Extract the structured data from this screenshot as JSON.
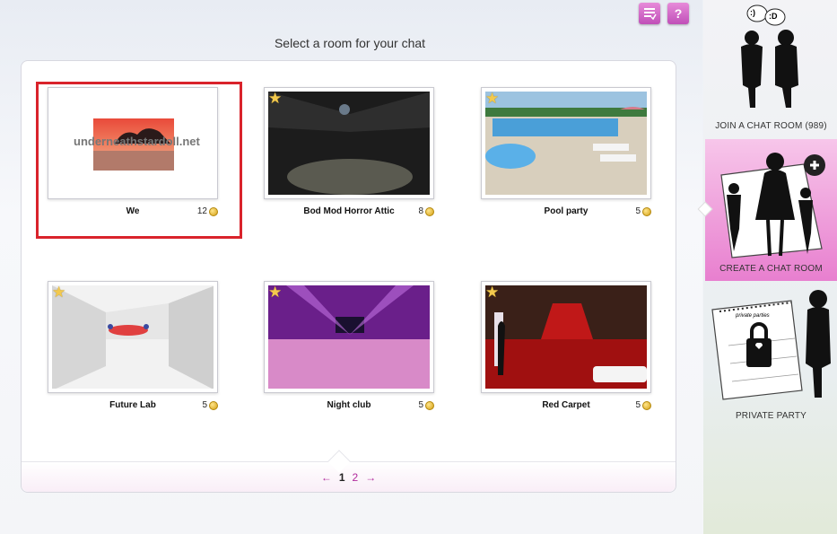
{
  "header": {
    "title": "Select a room for your chat",
    "icon_list": "list-check-icon",
    "icon_help": "help-icon",
    "help_glyph": "?"
  },
  "rooms": [
    {
      "name": "We",
      "count": "12",
      "starred": false,
      "selected": true,
      "watermark": "underneathstardoll.net"
    },
    {
      "name": "Bod Mod Horror Attic",
      "count": "8",
      "starred": true,
      "selected": false
    },
    {
      "name": "Pool party",
      "count": "5",
      "starred": true,
      "selected": false
    },
    {
      "name": "Future Lab",
      "count": "5",
      "starred": true,
      "selected": false
    },
    {
      "name": "Night club",
      "count": "5",
      "starred": true,
      "selected": false
    },
    {
      "name": "Red Carpet",
      "count": "5",
      "starred": true,
      "selected": false
    }
  ],
  "pager": {
    "prev": "←",
    "current": "1",
    "next_page": "2",
    "next": "→"
  },
  "sidebar": {
    "join": {
      "label": "JOIN A CHAT ROOM (989)",
      "speech1": ":)",
      "speech2": ":D"
    },
    "create": {
      "label": "CREATE A CHAT ROOM",
      "plus": "+"
    },
    "private": {
      "label": "PRIVATE PARTY",
      "calendar_title": "private parties"
    }
  },
  "colors": {
    "accent": "#b02a9c",
    "selection": "#d9232b",
    "coin": "#d4a017",
    "active_sidebar": "#e87fcf"
  }
}
